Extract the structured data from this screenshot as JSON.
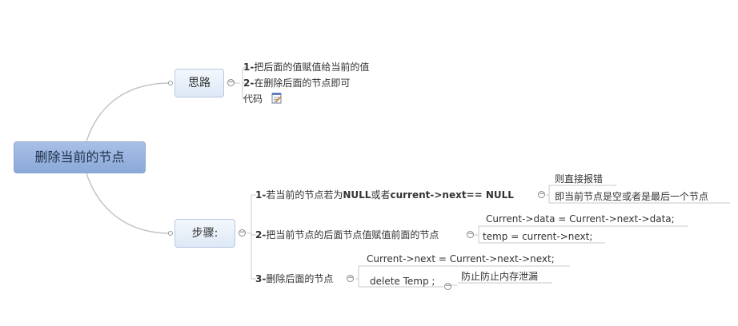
{
  "root": {
    "label": "删除当前的节点"
  },
  "branches": [
    {
      "label": "思路",
      "items": [
        {
          "prefix": "1-",
          "text": "把后面的值赋值给当前的值"
        },
        {
          "prefix": "2-",
          "text": "在删除后面的节点即可"
        },
        {
          "prefix": "",
          "text": "代码"
        }
      ],
      "note_icon": "notepad-icon"
    },
    {
      "label": "步骤:",
      "steps": [
        {
          "parts": [
            {
              "text": "1-",
              "bold": true
            },
            {
              "text": "若当前的节点若为",
              "bold": false
            },
            {
              "text": "NULL",
              "bold": true
            },
            {
              "text": "或者",
              "bold": false
            },
            {
              "text": "current->next== NULL",
              "bold": true
            }
          ],
          "children": [
            "则直接报错",
            "即当前节点是空或者是最后一个节点"
          ]
        },
        {
          "parts": [
            {
              "text": "2-",
              "bold": true
            },
            {
              "text": "把当前节点的后面节点值赋值前面的节点",
              "bold": false
            }
          ],
          "children": [
            "Current->data = Current->next->data;",
            "temp = current->next;"
          ]
        },
        {
          "parts": [
            {
              "text": "3-",
              "bold": true
            },
            {
              "text": "删除后面的节点",
              "bold": false
            }
          ],
          "children": [
            "Current->next = Current->next->next;",
            "delete Temp ;"
          ],
          "grandchild": "防止防止内存泄漏"
        }
      ]
    }
  ],
  "colors": {
    "root_bg": "#9ab4df",
    "topic_bg": "#e8f0fa",
    "line": "#bdbdbd"
  }
}
